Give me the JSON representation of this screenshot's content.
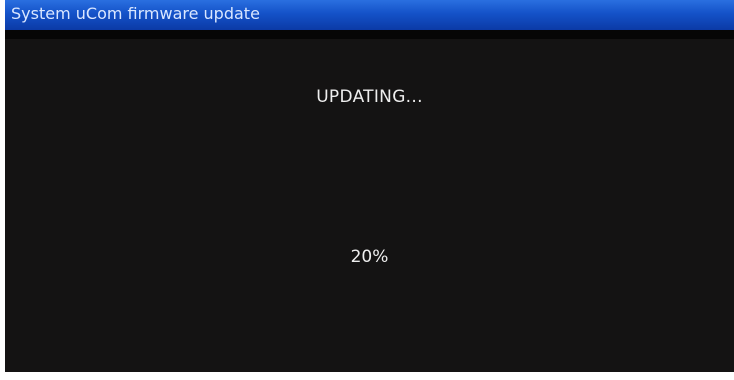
{
  "window": {
    "title": "System uCom firmware update"
  },
  "update": {
    "status": "UPDATING...",
    "progress_label": "20%",
    "progress_fraction": 0.2
  },
  "colors": {
    "title_bar": "#1452c8",
    "background": "#141313",
    "text": "#eeeeee"
  }
}
